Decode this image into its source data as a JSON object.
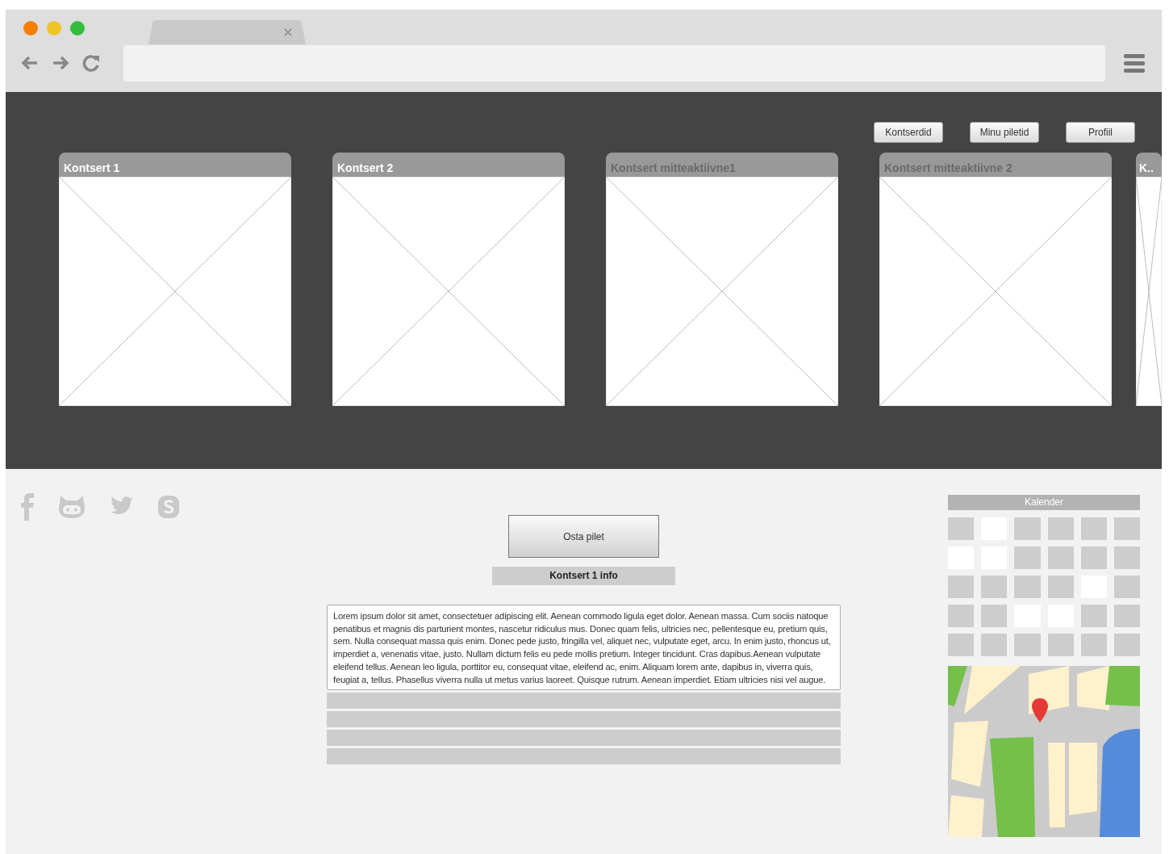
{
  "nav": [
    {
      "label": "Kontserdid"
    },
    {
      "label": "Minu piletid"
    },
    {
      "label": "Profiil"
    }
  ],
  "cards": [
    {
      "title": "Kontsert 1",
      "active": true
    },
    {
      "title": "Kontsert 2",
      "active": true
    },
    {
      "title": "Kontsert mitteaktiivne1",
      "active": false
    },
    {
      "title": "Kontsert mitteaktiivne 2",
      "active": false
    },
    {
      "title": "K..",
      "active": true
    }
  ],
  "buy_button": "Osta pilet",
  "info_title": "Kontsert 1 info",
  "description": "Lorem ipsum dolor sit amet, consectetuer adipiscing elit. Aenean commodo ligula eget dolor. Aenean massa. Cum sociis natoque penatibus et magnis dis parturient montes, nascetur ridiculus mus. Donec quam felis, ultricies nec, pellentesque eu, pretium quis, sem. Nulla consequat massa quis enim. Donec pede justo, fringilla vel, aliquet nec, vulputate eget, arcu. In enim justo, rhoncus ut, imperdiet a, venenatis vitae, justo. Nullam dictum felis eu pede mollis pretium. Integer tincidunt. Cras dapibus.Aenean vulputate eleifend tellus. Aenean leo ligula, porttitor eu, consequat vitae, eleifend ac, enim. Aliquam lorem ante, dapibus in, viverra quis, feugiat a, tellus. Phasellus viverra nulla ut metus varius laoreet. Quisque rutrum. Aenean imperdiet. Etiam ultricies nisi vel augue.",
  "info_rows": [
    {
      "kind": "bar"
    },
    {
      "kind": "bar"
    },
    {
      "kind": "bar"
    },
    {
      "kind": "bar"
    }
  ],
  "calendar": {
    "title": "Kalender",
    "weeks": [
      [
        {
          "highlighted": false
        },
        {
          "highlighted": true
        },
        {
          "highlighted": false
        },
        {
          "highlighted": false
        },
        {
          "highlighted": false
        },
        {
          "highlighted": false
        }
      ],
      [
        {
          "highlighted": true
        },
        {
          "highlighted": true
        },
        {
          "highlighted": false
        },
        {
          "highlighted": false
        },
        {
          "highlighted": false
        },
        {
          "highlighted": false
        }
      ],
      [
        {
          "highlighted": false
        },
        {
          "highlighted": false
        },
        {
          "highlighted": false
        },
        {
          "highlighted": false
        },
        {
          "highlighted": true
        },
        {
          "highlighted": false
        }
      ],
      [
        {
          "highlighted": false
        },
        {
          "highlighted": false
        },
        {
          "highlighted": true
        },
        {
          "highlighted": true
        },
        {
          "highlighted": false
        },
        {
          "highlighted": false
        }
      ],
      [
        {
          "highlighted": false
        },
        {
          "highlighted": false
        },
        {
          "highlighted": false
        },
        {
          "highlighted": false
        },
        {
          "highlighted": false
        },
        {
          "highlighted": false
        }
      ]
    ]
  }
}
